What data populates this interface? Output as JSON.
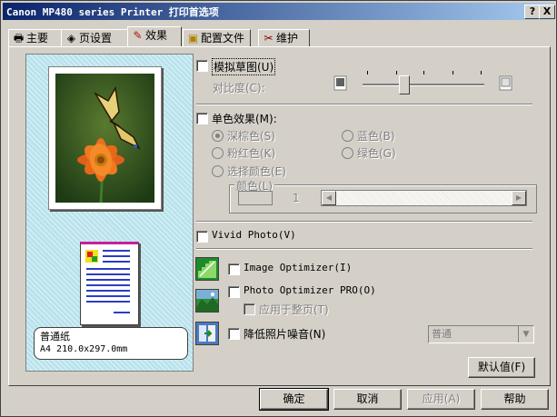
{
  "window": {
    "title": "Canon MP480 series Printer 打印首选项",
    "help_btn": "?",
    "close_btn": "X"
  },
  "tabs": [
    {
      "label": "主要",
      "icon": "printer-icon"
    },
    {
      "label": "页设置",
      "icon": "pages-icon"
    },
    {
      "label": "效果",
      "icon": "brush-icon"
    },
    {
      "label": "配置文件",
      "icon": "folder-icon"
    },
    {
      "label": "维护",
      "icon": "tools-icon"
    }
  ],
  "active_tab": "效果",
  "preview": {
    "media_type": "普通纸",
    "paper_size": "A4 210.0x297.0mm"
  },
  "effects": {
    "simulate_sketch": {
      "label": "模拟草图(U)",
      "checked": false
    },
    "contrast_label": "对比度(C):",
    "contrast_value": 0.5,
    "monochrome": {
      "label": "单色效果(M):",
      "checked": false
    },
    "colors": [
      {
        "label": "深棕色(S)",
        "selected": true
      },
      {
        "label": "蓝色(B)",
        "selected": false
      },
      {
        "label": "粉红色(K)",
        "selected": false
      },
      {
        "label": "绿色(G)",
        "selected": false
      },
      {
        "label": "选择颜色(E)",
        "selected": false
      }
    ],
    "color_group_label": "颜色(L)",
    "color_value": "1",
    "vivid_photo": {
      "label": "Vivid Photo(V)",
      "checked": false
    },
    "image_optimizer": {
      "label": "Image Optimizer(I)",
      "checked": false
    },
    "photo_optimizer": {
      "label": "Photo Optimizer PRO(O)",
      "checked": false
    },
    "apply_whole_page": {
      "label": "应用于整页(T)",
      "checked": false
    },
    "noise_reduction": {
      "label": "降低照片噪音(N)",
      "checked": false
    },
    "noise_level": "普通",
    "defaults_btn": "默认值(F)"
  },
  "footer": {
    "ok": "确定",
    "cancel": "取消",
    "apply": "应用(A)",
    "help": "帮助"
  },
  "colors": {
    "title_start": "#0a246a",
    "title_end": "#a6caf0",
    "dialog_bg": "#d4d0c8",
    "preview_bg": "#b9e3ec"
  }
}
